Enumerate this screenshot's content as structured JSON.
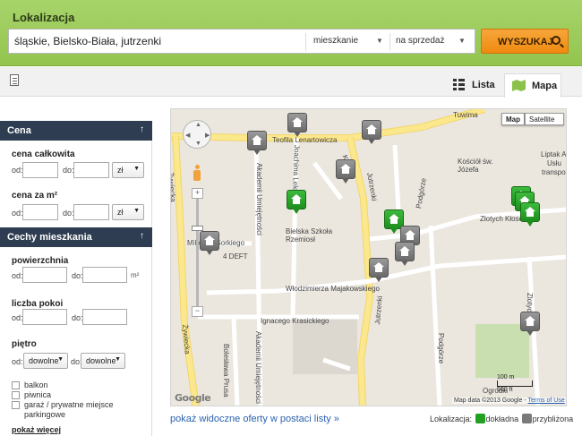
{
  "header": {
    "title": "Lokalizacja",
    "search_value": "śląskie, Bielsko-Biała, jutrzenki",
    "property_type": "mieszkanie",
    "transaction": "na sprzedaż",
    "search_button": "WYSZUKAJ"
  },
  "view_tabs": {
    "list": "Lista",
    "map": "Mapa",
    "active": "Mapa"
  },
  "sidebar": {
    "price": {
      "title": "Cena",
      "total_label": "cena całkowita",
      "per_m2_label": "cena za m²",
      "from": "od:",
      "to": "do:",
      "currency": "zł"
    },
    "features": {
      "title": "Cechy mieszkania",
      "area_label": "powierzchnia",
      "area_unit": "m²",
      "rooms_label": "liczba pokoi",
      "floor_label": "piętro",
      "floor_from": "dowolne",
      "floor_to": "dowolne",
      "checkboxes": [
        "balkon",
        "piwnica",
        "garaż / prywatne miejsce parkingowe"
      ],
      "more_link": "pokaż więcej"
    },
    "from_label": "od:",
    "to_label": "do:"
  },
  "map": {
    "type_buttons": [
      "Map",
      "Satellite"
    ],
    "street_labels": [
      "Teofila Lenartowicza",
      "Żywiecka",
      "Akademii Umiejętności",
      "Joachima Lelewela",
      "Karowa",
      "Jutrzenki",
      "Podgórze",
      "Złotych Kłosów",
      "Włodzimierza Majakowskiego",
      "Ignacego Krasickiego",
      "Bolesława Prusa",
      "Mikołaja Gorkiego",
      "Tuwima",
      "Zlotycki"
    ],
    "poi_labels": [
      "Bielska Szkoła Rzemiosł",
      "Kościół św. Józefa",
      "4 DEFT",
      "Liptak Ar",
      "Usłu",
      "transpo",
      "Ogrodki"
    ],
    "scale": [
      "100 m",
      "500 ft"
    ],
    "attribution": "Map data ©2013 Google",
    "terms": "Terms of Use",
    "logo": "Google",
    "show_list_link": "pokaż widoczne oferty w postaci listy »",
    "legend": {
      "label": "Lokalizacja:",
      "exact": "dokładna",
      "approx": "przybliżona"
    },
    "colors": {
      "exact_pin": "#22a022",
      "approx_pin": "#7a7a7a",
      "major_road": "#fbe88c",
      "park": "#c9dfb0"
    }
  }
}
